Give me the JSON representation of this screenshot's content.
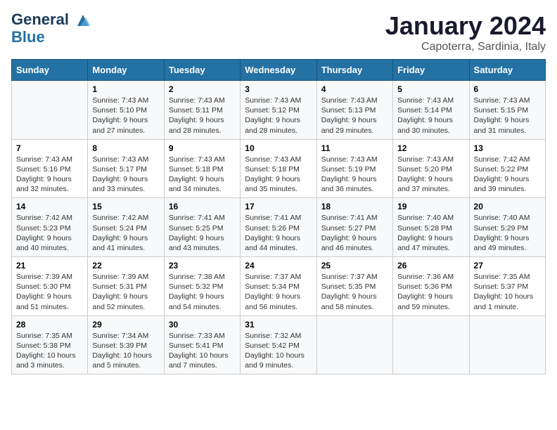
{
  "header": {
    "logo_line1": "General",
    "logo_line2": "Blue",
    "month_title": "January 2024",
    "location": "Capoterra, Sardinia, Italy"
  },
  "weekdays": [
    "Sunday",
    "Monday",
    "Tuesday",
    "Wednesday",
    "Thursday",
    "Friday",
    "Saturday"
  ],
  "weeks": [
    [
      {
        "day": "",
        "info": ""
      },
      {
        "day": "1",
        "info": "Sunrise: 7:43 AM\nSunset: 5:10 PM\nDaylight: 9 hours\nand 27 minutes."
      },
      {
        "day": "2",
        "info": "Sunrise: 7:43 AM\nSunset: 5:11 PM\nDaylight: 9 hours\nand 28 minutes."
      },
      {
        "day": "3",
        "info": "Sunrise: 7:43 AM\nSunset: 5:12 PM\nDaylight: 9 hours\nand 28 minutes."
      },
      {
        "day": "4",
        "info": "Sunrise: 7:43 AM\nSunset: 5:13 PM\nDaylight: 9 hours\nand 29 minutes."
      },
      {
        "day": "5",
        "info": "Sunrise: 7:43 AM\nSunset: 5:14 PM\nDaylight: 9 hours\nand 30 minutes."
      },
      {
        "day": "6",
        "info": "Sunrise: 7:43 AM\nSunset: 5:15 PM\nDaylight: 9 hours\nand 31 minutes."
      }
    ],
    [
      {
        "day": "7",
        "info": "Sunrise: 7:43 AM\nSunset: 5:16 PM\nDaylight: 9 hours\nand 32 minutes."
      },
      {
        "day": "8",
        "info": "Sunrise: 7:43 AM\nSunset: 5:17 PM\nDaylight: 9 hours\nand 33 minutes."
      },
      {
        "day": "9",
        "info": "Sunrise: 7:43 AM\nSunset: 5:18 PM\nDaylight: 9 hours\nand 34 minutes."
      },
      {
        "day": "10",
        "info": "Sunrise: 7:43 AM\nSunset: 5:18 PM\nDaylight: 9 hours\nand 35 minutes."
      },
      {
        "day": "11",
        "info": "Sunrise: 7:43 AM\nSunset: 5:19 PM\nDaylight: 9 hours\nand 36 minutes."
      },
      {
        "day": "12",
        "info": "Sunrise: 7:43 AM\nSunset: 5:20 PM\nDaylight: 9 hours\nand 37 minutes."
      },
      {
        "day": "13",
        "info": "Sunrise: 7:42 AM\nSunset: 5:22 PM\nDaylight: 9 hours\nand 39 minutes."
      }
    ],
    [
      {
        "day": "14",
        "info": "Sunrise: 7:42 AM\nSunset: 5:23 PM\nDaylight: 9 hours\nand 40 minutes."
      },
      {
        "day": "15",
        "info": "Sunrise: 7:42 AM\nSunset: 5:24 PM\nDaylight: 9 hours\nand 41 minutes."
      },
      {
        "day": "16",
        "info": "Sunrise: 7:41 AM\nSunset: 5:25 PM\nDaylight: 9 hours\nand 43 minutes."
      },
      {
        "day": "17",
        "info": "Sunrise: 7:41 AM\nSunset: 5:26 PM\nDaylight: 9 hours\nand 44 minutes."
      },
      {
        "day": "18",
        "info": "Sunrise: 7:41 AM\nSunset: 5:27 PM\nDaylight: 9 hours\nand 46 minutes."
      },
      {
        "day": "19",
        "info": "Sunrise: 7:40 AM\nSunset: 5:28 PM\nDaylight: 9 hours\nand 47 minutes."
      },
      {
        "day": "20",
        "info": "Sunrise: 7:40 AM\nSunset: 5:29 PM\nDaylight: 9 hours\nand 49 minutes."
      }
    ],
    [
      {
        "day": "21",
        "info": "Sunrise: 7:39 AM\nSunset: 5:30 PM\nDaylight: 9 hours\nand 51 minutes."
      },
      {
        "day": "22",
        "info": "Sunrise: 7:39 AM\nSunset: 5:31 PM\nDaylight: 9 hours\nand 52 minutes."
      },
      {
        "day": "23",
        "info": "Sunrise: 7:38 AM\nSunset: 5:32 PM\nDaylight: 9 hours\nand 54 minutes."
      },
      {
        "day": "24",
        "info": "Sunrise: 7:37 AM\nSunset: 5:34 PM\nDaylight: 9 hours\nand 56 minutes."
      },
      {
        "day": "25",
        "info": "Sunrise: 7:37 AM\nSunset: 5:35 PM\nDaylight: 9 hours\nand 58 minutes."
      },
      {
        "day": "26",
        "info": "Sunrise: 7:36 AM\nSunset: 5:36 PM\nDaylight: 9 hours\nand 59 minutes."
      },
      {
        "day": "27",
        "info": "Sunrise: 7:35 AM\nSunset: 5:37 PM\nDaylight: 10 hours\nand 1 minute."
      }
    ],
    [
      {
        "day": "28",
        "info": "Sunrise: 7:35 AM\nSunset: 5:38 PM\nDaylight: 10 hours\nand 3 minutes."
      },
      {
        "day": "29",
        "info": "Sunrise: 7:34 AM\nSunset: 5:39 PM\nDaylight: 10 hours\nand 5 minutes."
      },
      {
        "day": "30",
        "info": "Sunrise: 7:33 AM\nSunset: 5:41 PM\nDaylight: 10 hours\nand 7 minutes."
      },
      {
        "day": "31",
        "info": "Sunrise: 7:32 AM\nSunset: 5:42 PM\nDaylight: 10 hours\nand 9 minutes."
      },
      {
        "day": "",
        "info": ""
      },
      {
        "day": "",
        "info": ""
      },
      {
        "day": "",
        "info": ""
      }
    ]
  ]
}
